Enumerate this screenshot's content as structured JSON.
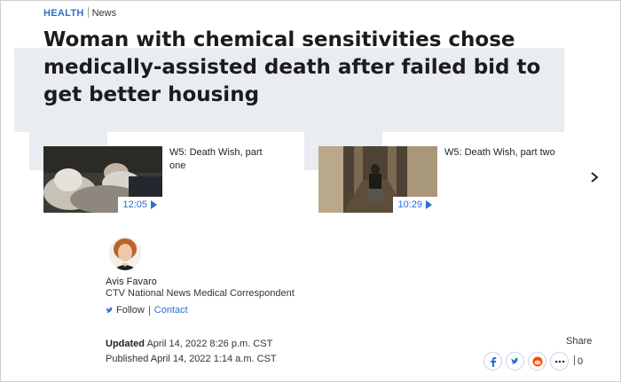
{
  "section": {
    "category": "HEALTH",
    "subcategory": "News"
  },
  "headline": "Woman with chemical sensitivities chose medically-assisted death after failed bid to get better housing",
  "videos": [
    {
      "title": "W5: Death Wish, part one",
      "duration": "12:05"
    },
    {
      "title": "W5: Death Wish, part two",
      "duration": "10:29"
    }
  ],
  "author": {
    "name": "Avis Favaro",
    "role": "CTV National News Medical Correspondent",
    "follow_label": "Follow",
    "contact_label": "Contact"
  },
  "dates": {
    "updated_label": "Updated",
    "updated_value": "April 14, 2022 8:26 p.m. CST",
    "published_label": "Published",
    "published_value": "April 14, 2022 1:14 a.m. CST"
  },
  "share": {
    "label": "Share",
    "count": "0",
    "buttons": [
      "facebook-icon",
      "twitter-icon",
      "reddit-icon",
      "more-icon"
    ]
  },
  "colors": {
    "accent": "#2a6fcf",
    "band": "#e9ecf0"
  }
}
